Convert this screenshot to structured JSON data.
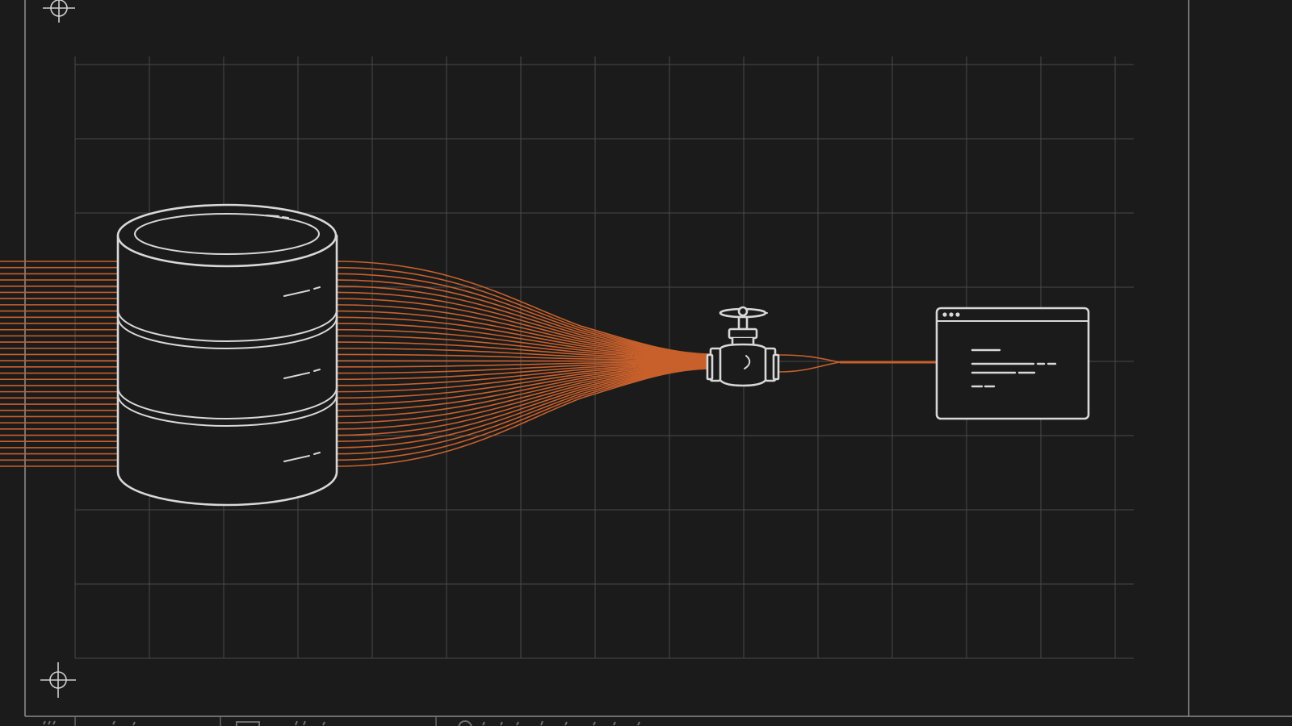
{
  "diagram": {
    "components": [
      {
        "id": "database",
        "icon": "database-cylinder-icon"
      },
      {
        "id": "valve",
        "icon": "valve-icon"
      },
      {
        "id": "app-window",
        "icon": "browser-window-icon"
      }
    ],
    "connections": [
      {
        "from": "database",
        "to": "valve",
        "style": "many-strand-bundle"
      },
      {
        "from": "valve",
        "to": "app-window",
        "style": "single-strand"
      }
    ],
    "colors": {
      "background": "#1b1b1b",
      "grid": "#4a4a4a",
      "outline": "#d8d8d8",
      "flow": "#c8602c"
    }
  }
}
